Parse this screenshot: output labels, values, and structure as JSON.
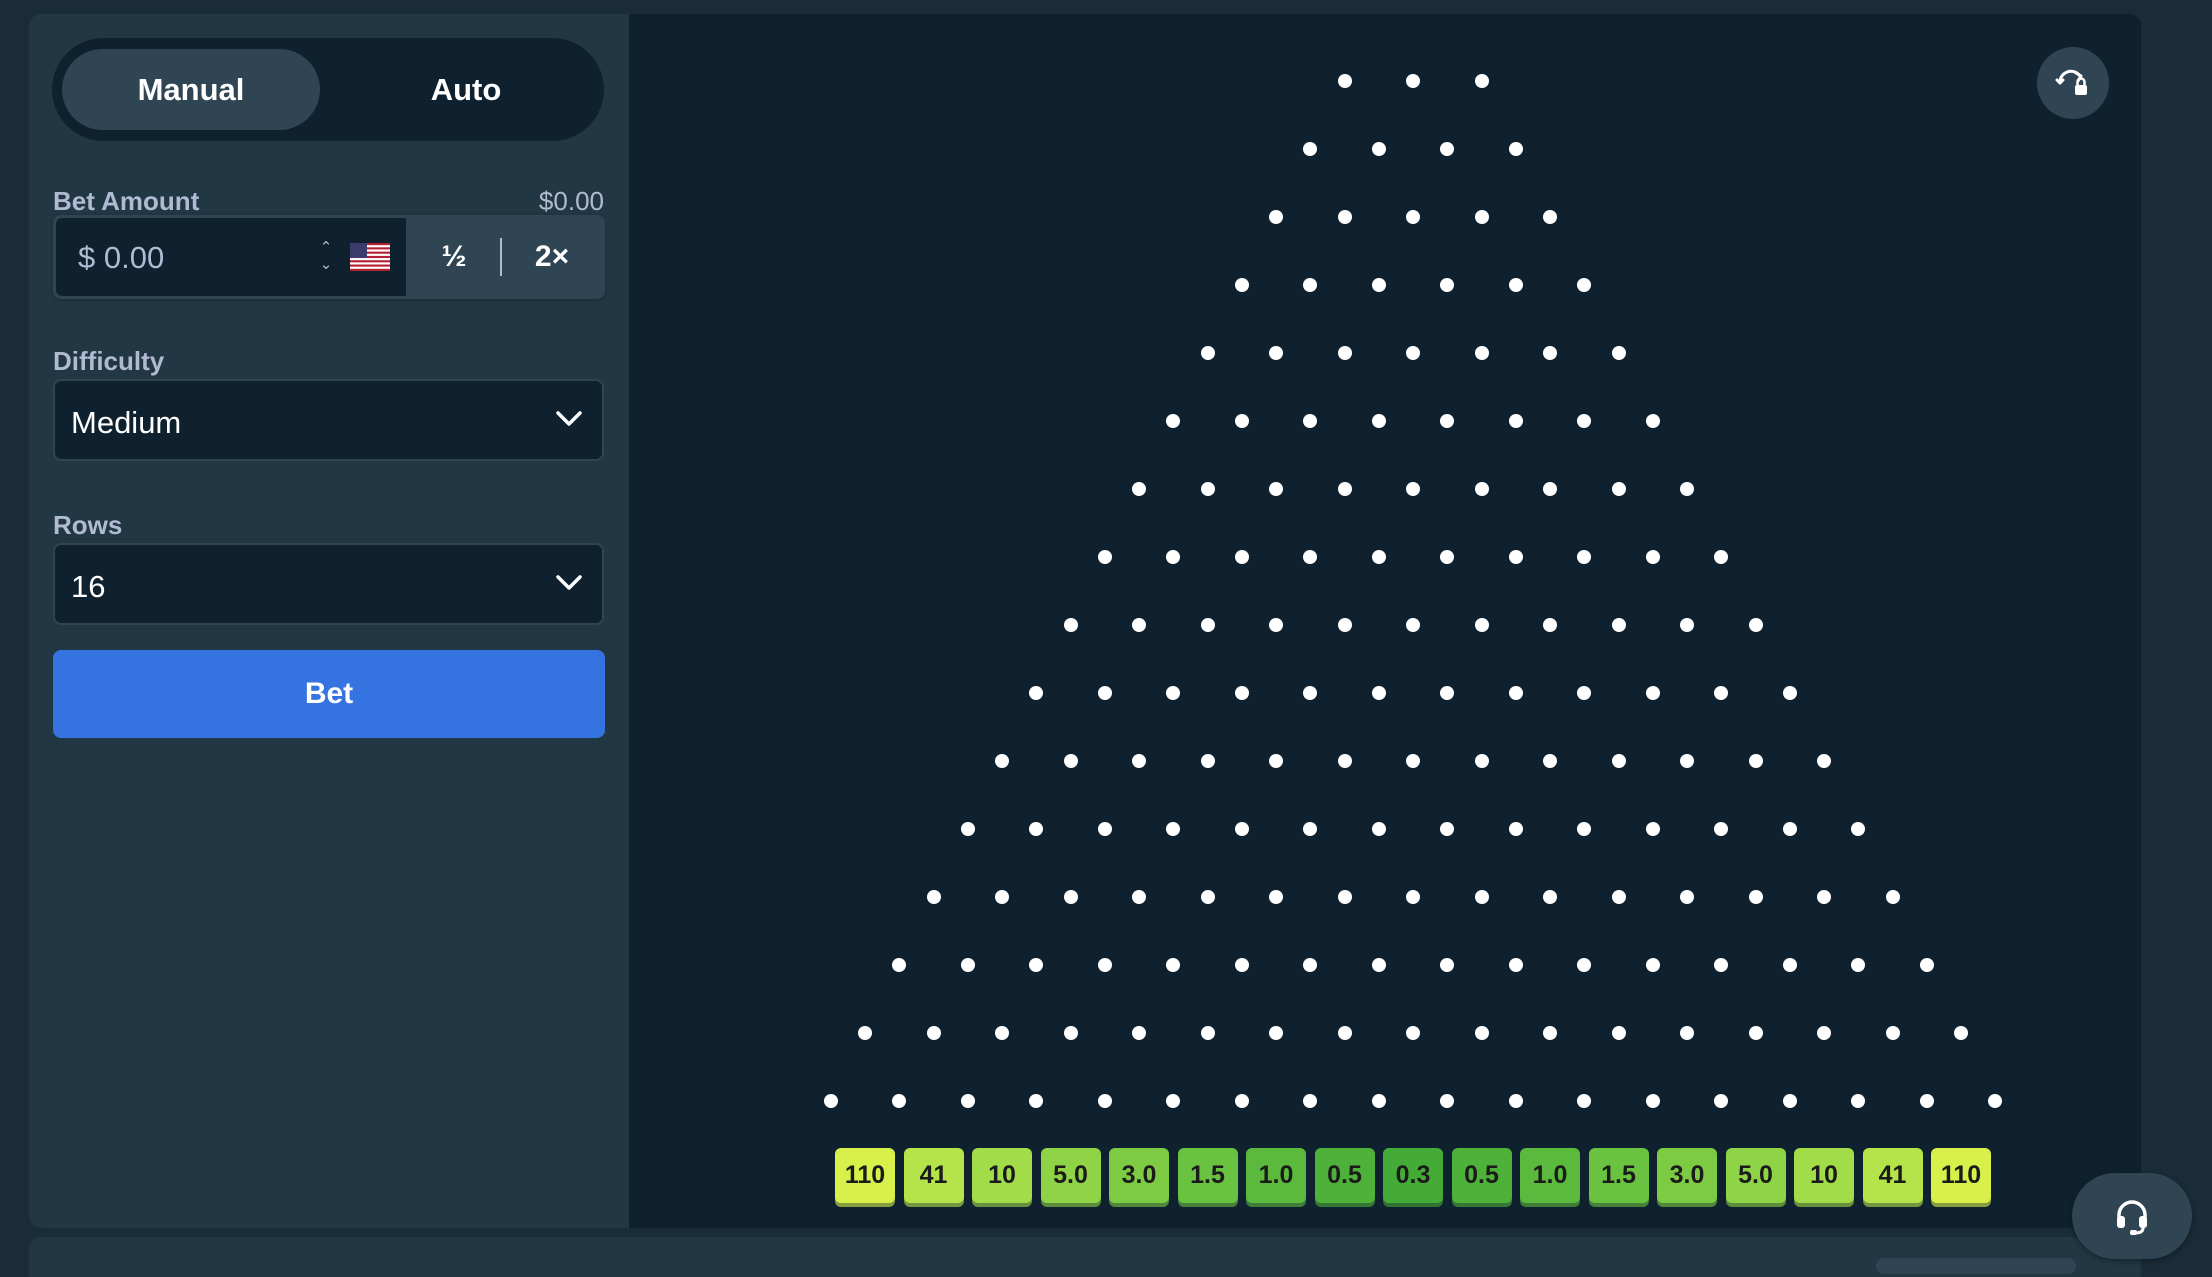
{
  "mode_tabs": [
    {
      "label": "Manual",
      "active": true
    },
    {
      "label": "Auto",
      "active": false
    }
  ],
  "bet": {
    "label": "Bet Amount",
    "balance": "$0.00",
    "placeholder": "$ 0.00",
    "value": "",
    "half_label": "½",
    "double_label": "2×",
    "currency_icon": "us-flag-icon"
  },
  "difficulty": {
    "label": "Difficulty",
    "value": "Medium"
  },
  "rows": {
    "label": "Rows",
    "value": "16"
  },
  "bet_button": "Bet",
  "board": {
    "peg_rows": 16,
    "buckets": [
      "110",
      "41",
      "10",
      "5.0",
      "3.0",
      "1.5",
      "1.0",
      "0.5",
      "0.3",
      "0.5",
      "1.0",
      "1.5",
      "3.0",
      "5.0",
      "10",
      "41",
      "110"
    ],
    "bucket_colors": [
      "#d7f04a",
      "#b5e44a",
      "#a2dc48",
      "#8fd346",
      "#7dcb43",
      "#6ac241",
      "#5bba3d",
      "#4eb23a",
      "#44ab37",
      "#4eb23a",
      "#5bba3d",
      "#6ac241",
      "#7dcb43",
      "#8fd346",
      "#a2dc48",
      "#b5e44a",
      "#d7f04a"
    ]
  },
  "icons": {
    "top_right": "fairness-icon",
    "support": "headset-icon"
  },
  "colors": {
    "page_bg": "#1a2c38",
    "sidebar_bg": "#213743",
    "board_bg": "#0f212e",
    "accent": "#3574e0",
    "muted_text": "#b1bad3"
  }
}
